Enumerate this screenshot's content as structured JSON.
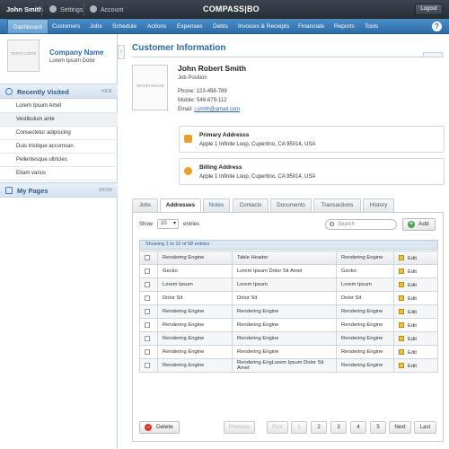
{
  "topbar": {
    "user": "John Smith",
    "settings": "Settings",
    "account": "Account",
    "brand": "COMPASS|BO",
    "logout": "Logout"
  },
  "nav": [
    "Dashboard",
    "Customers",
    "Jobs",
    "Schedule",
    "Actions",
    "Expenses",
    "Debts",
    "Invoices & Receipts",
    "Financials",
    "Reports",
    "Tools"
  ],
  "sidebar": {
    "logo_text": "TEXTS LOGO",
    "company_name": "Company Name",
    "company_sub": "Lorem Ipsum Dolor",
    "recent_title": "Recently Visited",
    "recent_action": "HIDE",
    "recent_items": [
      "Lorem Ipsum Amet",
      "Vestibulum ante",
      "Consectetur adipiscing",
      "Duis tristique accumsan",
      "Pellentesque ultricies",
      "Etiam varius"
    ],
    "pages_title": "My Pages",
    "pages_action": "SHOW"
  },
  "main": {
    "title": "Customer Information",
    "image_text": "75X100 IMAGE",
    "name": "John Robert Smith",
    "position": "Job Position",
    "phone": "Phone: 123-456-789",
    "mobile": "Mobile: 546-879-112",
    "email_label": "Email:",
    "email": "j.smith@gmail.com",
    "primary_title": "Primary Addresss",
    "primary_text": "Apple 1 Infinite Loop, Cupertino, CA 95014, USA",
    "billing_title": "Billing Address",
    "billing_text": "Apple 1 Infinite Loop, Cupertino, CA 95014, USA"
  },
  "tabs": [
    "Jobs",
    "Addresses",
    "Notes",
    "Contacts",
    "Documents",
    "Transactions",
    "History"
  ],
  "table": {
    "show": "Show",
    "select_value": "10",
    "entries": "entries",
    "search_placeholder": "Search",
    "add": "Add",
    "info": "Showing 1 to 10 of 58 entries",
    "headers": [
      "Rendering Engine",
      "Table Header",
      "Rendering Engine",
      "Edit"
    ],
    "rows": [
      [
        "Gecko",
        "Lorem Ipsum Dolor Sit Amet",
        "Gecko",
        "Edit"
      ],
      [
        "Lorem Ipsum",
        "Lorem Ipsum",
        "Lorem Ipsum",
        "Edit"
      ],
      [
        "Dolor Sit",
        "Dolor Sit",
        "Dolor Sit",
        "Edit"
      ],
      [
        "Rendering Engine",
        "Rendering Engine",
        "Rendering Engine",
        "Edit"
      ],
      [
        "Rendering Engine",
        "Rendering Engine",
        "Rendering Engine",
        "Edit"
      ],
      [
        "Rendering Engine",
        "Rendering Engine",
        "Rendering Engine",
        "Edit"
      ],
      [
        "Rendering Engine",
        "Rendering Engine",
        "Rendering Engine",
        "Edit"
      ],
      [
        "Rendering Engine",
        "Rendering EngLorem Ipsum Dolor Sit Amet",
        "Rendering Engine",
        "Edit"
      ]
    ],
    "delete": "Delete",
    "pages": [
      "Previous",
      "First",
      "1",
      "2",
      "3",
      "4",
      "5",
      "Next",
      "Last"
    ]
  }
}
